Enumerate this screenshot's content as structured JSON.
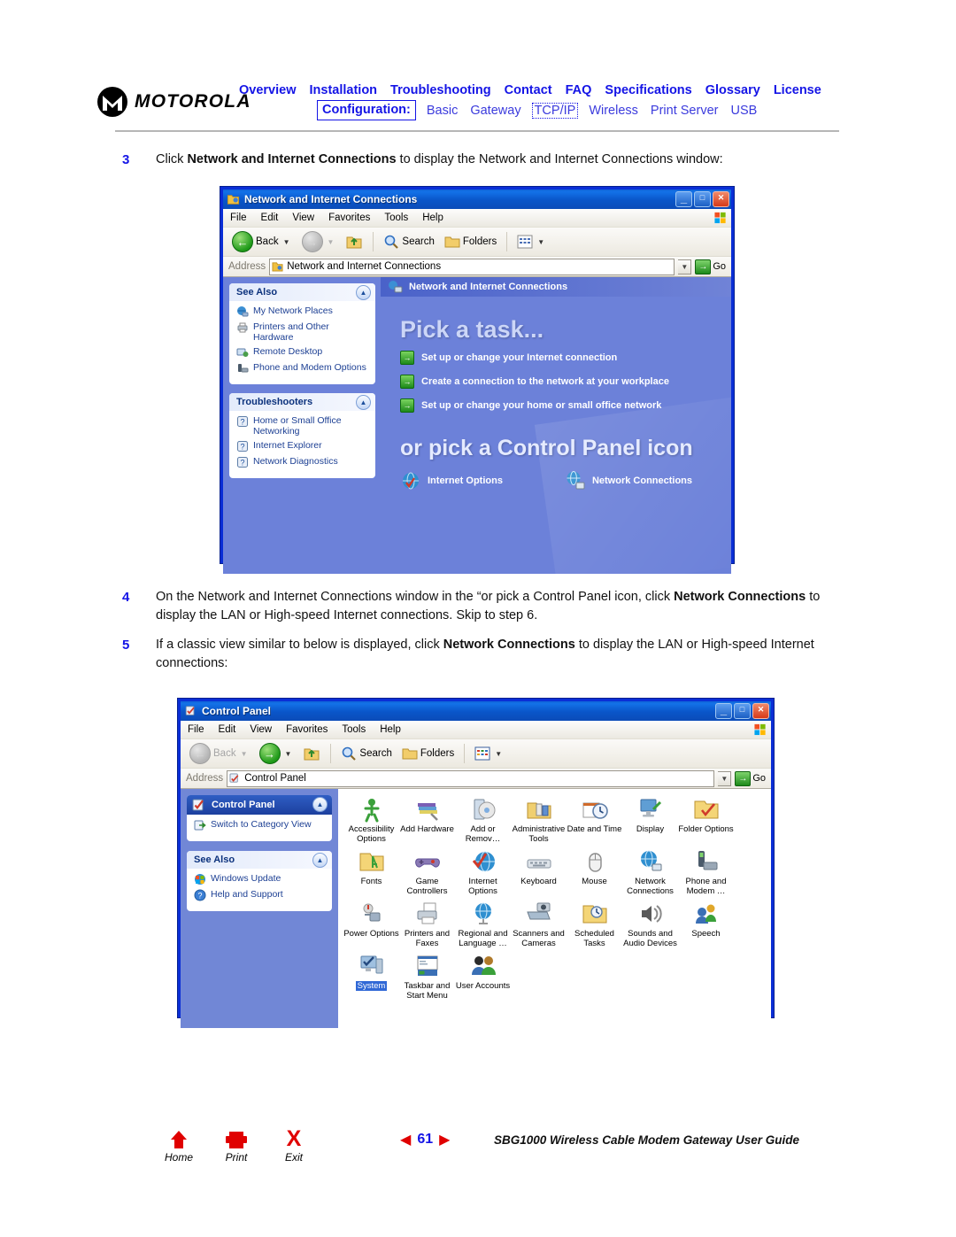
{
  "header": {
    "brand": "MOTOROLA",
    "nav_primary": [
      "Overview",
      "Installation",
      "Troubleshooting",
      "Contact",
      "FAQ",
      "Specifications",
      "Glossary",
      "License"
    ],
    "configuration_label": "Configuration:",
    "nav_secondary": [
      "Basic",
      "Gateway",
      "TCP/IP",
      "Wireless",
      "Print Server",
      "USB"
    ],
    "nav_secondary_active": "TCP/IP"
  },
  "steps": [
    {
      "number": "3",
      "parts": [
        {
          "t": "Click ",
          "b": false
        },
        {
          "t": "Network and Internet Connections",
          "b": true
        },
        {
          "t": " to display the Network and Internet Connections window:",
          "b": false
        }
      ]
    },
    {
      "number": "4",
      "parts": [
        {
          "t": "On the Network and Internet Connections window in the “or pick a Control Panel icon, click ",
          "b": false
        },
        {
          "t": "Network Connections",
          "b": true
        },
        {
          "t": " to display the LAN or High-speed Internet connections. Skip to step 6.",
          "b": false
        }
      ]
    },
    {
      "number": "5",
      "parts": [
        {
          "t": "If a classic view similar to below is displayed, click ",
          "b": false
        },
        {
          "t": "Network Connections",
          "b": true
        },
        {
          "t": " to display the LAN or High-speed Internet connections:",
          "b": false
        }
      ]
    }
  ],
  "window1": {
    "title": "Network and Internet Connections",
    "title_icon": "folder-network-icon",
    "menus": [
      "File",
      "Edit",
      "View",
      "Favorites",
      "Tools",
      "Help"
    ],
    "toolbar": {
      "back": "Back",
      "search": "Search",
      "folders": "Folders",
      "views_icon": "views-icon"
    },
    "address": {
      "label": "Address",
      "value": "Network and Internet Connections",
      "go": "Go"
    },
    "sidebar": {
      "panels": [
        {
          "title": "See Also",
          "items": [
            {
              "label": "My Network Places",
              "icon": "network-places-icon"
            },
            {
              "label": "Printers and Other Hardware",
              "icon": "printer-icon"
            },
            {
              "label": "Remote Desktop",
              "icon": "remote-desktop-icon"
            },
            {
              "label": "Phone and Modem Options",
              "icon": "phone-modem-icon"
            }
          ]
        },
        {
          "title": "Troubleshooters",
          "items": [
            {
              "label": "Home or Small Office Networking",
              "icon": "help-question-icon"
            },
            {
              "label": "Internet Explorer",
              "icon": "help-question-icon"
            },
            {
              "label": "Network Diagnostics",
              "icon": "help-question-icon"
            }
          ]
        }
      ]
    },
    "main": {
      "banner": "Network and Internet Connections",
      "heading1": "Pick a task...",
      "tasks": [
        "Set up or change your Internet connection",
        "Create a connection to the network at your workplace",
        "Set up or change your home or small office network"
      ],
      "heading2": "or pick a Control Panel icon",
      "cp_icons": [
        {
          "label": "Internet Options",
          "icon": "internet-options-icon"
        },
        {
          "label": "Network Connections",
          "icon": "network-connections-icon"
        }
      ]
    }
  },
  "window2": {
    "title": "Control Panel",
    "title_icon": "control-panel-icon",
    "menus": [
      "File",
      "Edit",
      "View",
      "Favorites",
      "Tools",
      "Help"
    ],
    "toolbar": {
      "back": "Back",
      "search": "Search",
      "folders": "Folders",
      "views_icon": "views-icon"
    },
    "address": {
      "label": "Address",
      "value": "Control Panel",
      "go": "Go"
    },
    "sidebar": {
      "panels": [
        {
          "title": "Control Panel",
          "icon": "control-panel-icon",
          "items": [
            {
              "label": "Switch to Category View",
              "icon": "switch-view-icon"
            }
          ]
        },
        {
          "title": "See Also",
          "items": [
            {
              "label": "Windows Update",
              "icon": "windows-update-icon"
            },
            {
              "label": "Help and Support",
              "icon": "help-support-icon"
            }
          ]
        }
      ]
    },
    "icons": [
      {
        "label": "Accessibility Options",
        "icon": "accessibility-icon",
        "selected": false
      },
      {
        "label": "Add Hardware",
        "icon": "add-hardware-icon",
        "selected": false
      },
      {
        "label": "Add or Remov…",
        "icon": "add-remove-programs-icon",
        "selected": false
      },
      {
        "label": "Administrative Tools",
        "icon": "administrative-tools-icon",
        "selected": false
      },
      {
        "label": "Date and Time",
        "icon": "date-time-icon",
        "selected": false
      },
      {
        "label": "Display",
        "icon": "display-icon",
        "selected": false
      },
      {
        "label": "Folder Options",
        "icon": "folder-options-icon",
        "selected": false
      },
      {
        "label": "Fonts",
        "icon": "fonts-icon",
        "selected": false
      },
      {
        "label": "Game Controllers",
        "icon": "game-controllers-icon",
        "selected": false
      },
      {
        "label": "Internet Options",
        "icon": "internet-options-icon",
        "selected": false
      },
      {
        "label": "Keyboard",
        "icon": "keyboard-icon",
        "selected": false
      },
      {
        "label": "Mouse",
        "icon": "mouse-icon",
        "selected": false
      },
      {
        "label": "Network Connections",
        "icon": "network-connections-icon",
        "selected": false
      },
      {
        "label": "Phone and Modem …",
        "icon": "phone-modem-icon",
        "selected": false
      },
      {
        "label": "Power Options",
        "icon": "power-options-icon",
        "selected": false
      },
      {
        "label": "Printers and Faxes",
        "icon": "printers-faxes-icon",
        "selected": false
      },
      {
        "label": "Regional and Language …",
        "icon": "regional-language-icon",
        "selected": false
      },
      {
        "label": "Scanners and Cameras",
        "icon": "scanners-cameras-icon",
        "selected": false
      },
      {
        "label": "Scheduled Tasks",
        "icon": "scheduled-tasks-icon",
        "selected": false
      },
      {
        "label": "Sounds and Audio Devices",
        "icon": "sounds-audio-icon",
        "selected": false
      },
      {
        "label": "Speech",
        "icon": "speech-icon",
        "selected": false
      },
      {
        "label": "System",
        "icon": "system-icon",
        "selected": true
      },
      {
        "label": "Taskbar and Start Menu",
        "icon": "taskbar-startmenu-icon",
        "selected": false
      },
      {
        "label": "User Accounts",
        "icon": "user-accounts-icon",
        "selected": false
      }
    ]
  },
  "footer": {
    "buttons": [
      {
        "label": "Home",
        "icon": "home-icon"
      },
      {
        "label": "Print",
        "icon": "print-icon"
      },
      {
        "label": "Exit",
        "icon": "exit-icon"
      }
    ],
    "page_number": "61",
    "prev_arrow": "◀",
    "next_arrow": "▶",
    "doc_title": "SBG1000 Wireless Cable Modem Gateway User Guide"
  },
  "colors": {
    "link_blue": "#1414e6",
    "accent_red": "#e00000",
    "xp_blue": "#0a2ed6",
    "sidebar_blue": "#6c81d9"
  }
}
